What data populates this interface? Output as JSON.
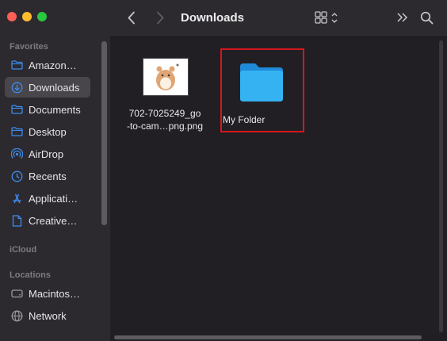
{
  "toolbar": {
    "title": "Downloads"
  },
  "sidebar": {
    "favorites_label": "Favorites",
    "icloud_label": "iCloud",
    "locations_label": "Locations",
    "items": [
      {
        "label": "Amazon…",
        "icon": "folder-icon"
      },
      {
        "label": "Downloads",
        "icon": "downloads-icon",
        "selected": true
      },
      {
        "label": "Documents",
        "icon": "folder-icon"
      },
      {
        "label": "Desktop",
        "icon": "folder-icon"
      },
      {
        "label": "AirDrop",
        "icon": "airdrop-icon"
      },
      {
        "label": "Recents",
        "icon": "clock-icon"
      },
      {
        "label": "Applicati…",
        "icon": "applications-icon"
      },
      {
        "label": "Creative…",
        "icon": "document-icon"
      }
    ],
    "locations": [
      {
        "label": "Macintos…",
        "icon": "hard-drive-icon"
      },
      {
        "label": "Network",
        "icon": "network-icon"
      }
    ]
  },
  "content": {
    "files": [
      {
        "name_line1": "702-7025249_go",
        "name_line2": "-to-cam…png.png",
        "kind": "image"
      },
      {
        "name": "My Folder",
        "kind": "folder",
        "highlighted": true
      }
    ]
  },
  "colors": {
    "accent_highlight": "#d4171e",
    "folder_blue": "#2ea8ee",
    "sidebar_icon": "#3d8cf0"
  }
}
